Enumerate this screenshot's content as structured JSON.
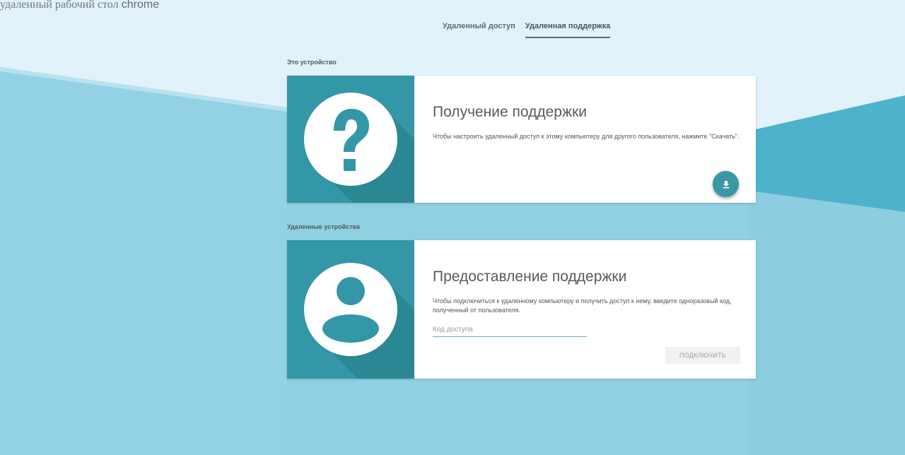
{
  "app": {
    "logo_part1": "удаленный рабочий стол",
    "logo_part2": "chrome"
  },
  "tabs": [
    {
      "label": "Удаленный доступ",
      "active": false
    },
    {
      "label": "Удаленная поддержка",
      "active": true
    }
  ],
  "sections": {
    "this_device": "Это устройство",
    "remote_devices": "Удаленные устройства"
  },
  "get_support": {
    "title": "Получение поддержки",
    "description": "Чтобы настроить удаленный доступ к этому компьютеру для другого пользователя, нажмите \"Скачать\".",
    "icon": "help-icon",
    "action_icon": "download-icon"
  },
  "give_support": {
    "title": "Предоставление поддержки",
    "description": "Чтобы подключиться к удаленному компьютеру и получить доступ к нему, введите одноразовый код, полученный от пользователя.",
    "icon": "person-icon",
    "code_value": "",
    "code_placeholder": "Код доступа",
    "connect_label": "ПОДКЛЮЧИТЬ"
  },
  "colors": {
    "accent": "#3397a8",
    "accent_dark": "#2c8795",
    "background_light": "#e1f2fb",
    "background_blue": "#8fd0e2"
  }
}
